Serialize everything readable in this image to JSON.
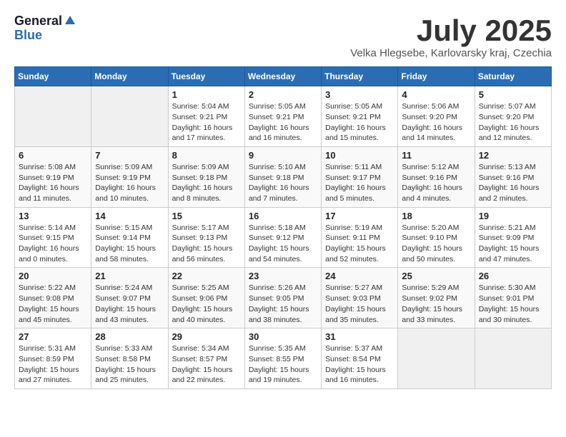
{
  "header": {
    "logo_general": "General",
    "logo_blue": "Blue",
    "month_title": "July 2025",
    "location": "Velka Hlegsebe, Karlovarsky kraj, Czechia"
  },
  "weekdays": [
    "Sunday",
    "Monday",
    "Tuesday",
    "Wednesday",
    "Thursday",
    "Friday",
    "Saturday"
  ],
  "weeks": [
    [
      {
        "day": "",
        "info": ""
      },
      {
        "day": "",
        "info": ""
      },
      {
        "day": "1",
        "info": "Sunrise: 5:04 AM\nSunset: 9:21 PM\nDaylight: 16 hours\nand 17 minutes."
      },
      {
        "day": "2",
        "info": "Sunrise: 5:05 AM\nSunset: 9:21 PM\nDaylight: 16 hours\nand 16 minutes."
      },
      {
        "day": "3",
        "info": "Sunrise: 5:05 AM\nSunset: 9:21 PM\nDaylight: 16 hours\nand 15 minutes."
      },
      {
        "day": "4",
        "info": "Sunrise: 5:06 AM\nSunset: 9:20 PM\nDaylight: 16 hours\nand 14 minutes."
      },
      {
        "day": "5",
        "info": "Sunrise: 5:07 AM\nSunset: 9:20 PM\nDaylight: 16 hours\nand 12 minutes."
      }
    ],
    [
      {
        "day": "6",
        "info": "Sunrise: 5:08 AM\nSunset: 9:19 PM\nDaylight: 16 hours\nand 11 minutes."
      },
      {
        "day": "7",
        "info": "Sunrise: 5:09 AM\nSunset: 9:19 PM\nDaylight: 16 hours\nand 10 minutes."
      },
      {
        "day": "8",
        "info": "Sunrise: 5:09 AM\nSunset: 9:18 PM\nDaylight: 16 hours\nand 8 minutes."
      },
      {
        "day": "9",
        "info": "Sunrise: 5:10 AM\nSunset: 9:18 PM\nDaylight: 16 hours\nand 7 minutes."
      },
      {
        "day": "10",
        "info": "Sunrise: 5:11 AM\nSunset: 9:17 PM\nDaylight: 16 hours\nand 5 minutes."
      },
      {
        "day": "11",
        "info": "Sunrise: 5:12 AM\nSunset: 9:16 PM\nDaylight: 16 hours\nand 4 minutes."
      },
      {
        "day": "12",
        "info": "Sunrise: 5:13 AM\nSunset: 9:16 PM\nDaylight: 16 hours\nand 2 minutes."
      }
    ],
    [
      {
        "day": "13",
        "info": "Sunrise: 5:14 AM\nSunset: 9:15 PM\nDaylight: 16 hours\nand 0 minutes."
      },
      {
        "day": "14",
        "info": "Sunrise: 5:15 AM\nSunset: 9:14 PM\nDaylight: 15 hours\nand 58 minutes."
      },
      {
        "day": "15",
        "info": "Sunrise: 5:17 AM\nSunset: 9:13 PM\nDaylight: 15 hours\nand 56 minutes."
      },
      {
        "day": "16",
        "info": "Sunrise: 5:18 AM\nSunset: 9:12 PM\nDaylight: 15 hours\nand 54 minutes."
      },
      {
        "day": "17",
        "info": "Sunrise: 5:19 AM\nSunset: 9:11 PM\nDaylight: 15 hours\nand 52 minutes."
      },
      {
        "day": "18",
        "info": "Sunrise: 5:20 AM\nSunset: 9:10 PM\nDaylight: 15 hours\nand 50 minutes."
      },
      {
        "day": "19",
        "info": "Sunrise: 5:21 AM\nSunset: 9:09 PM\nDaylight: 15 hours\nand 47 minutes."
      }
    ],
    [
      {
        "day": "20",
        "info": "Sunrise: 5:22 AM\nSunset: 9:08 PM\nDaylight: 15 hours\nand 45 minutes."
      },
      {
        "day": "21",
        "info": "Sunrise: 5:24 AM\nSunset: 9:07 PM\nDaylight: 15 hours\nand 43 minutes."
      },
      {
        "day": "22",
        "info": "Sunrise: 5:25 AM\nSunset: 9:06 PM\nDaylight: 15 hours\nand 40 minutes."
      },
      {
        "day": "23",
        "info": "Sunrise: 5:26 AM\nSunset: 9:05 PM\nDaylight: 15 hours\nand 38 minutes."
      },
      {
        "day": "24",
        "info": "Sunrise: 5:27 AM\nSunset: 9:03 PM\nDaylight: 15 hours\nand 35 minutes."
      },
      {
        "day": "25",
        "info": "Sunrise: 5:29 AM\nSunset: 9:02 PM\nDaylight: 15 hours\nand 33 minutes."
      },
      {
        "day": "26",
        "info": "Sunrise: 5:30 AM\nSunset: 9:01 PM\nDaylight: 15 hours\nand 30 minutes."
      }
    ],
    [
      {
        "day": "27",
        "info": "Sunrise: 5:31 AM\nSunset: 8:59 PM\nDaylight: 15 hours\nand 27 minutes."
      },
      {
        "day": "28",
        "info": "Sunrise: 5:33 AM\nSunset: 8:58 PM\nDaylight: 15 hours\nand 25 minutes."
      },
      {
        "day": "29",
        "info": "Sunrise: 5:34 AM\nSunset: 8:57 PM\nDaylight: 15 hours\nand 22 minutes."
      },
      {
        "day": "30",
        "info": "Sunrise: 5:35 AM\nSunset: 8:55 PM\nDaylight: 15 hours\nand 19 minutes."
      },
      {
        "day": "31",
        "info": "Sunrise: 5:37 AM\nSunset: 8:54 PM\nDaylight: 15 hours\nand 16 minutes."
      },
      {
        "day": "",
        "info": ""
      },
      {
        "day": "",
        "info": ""
      }
    ]
  ]
}
